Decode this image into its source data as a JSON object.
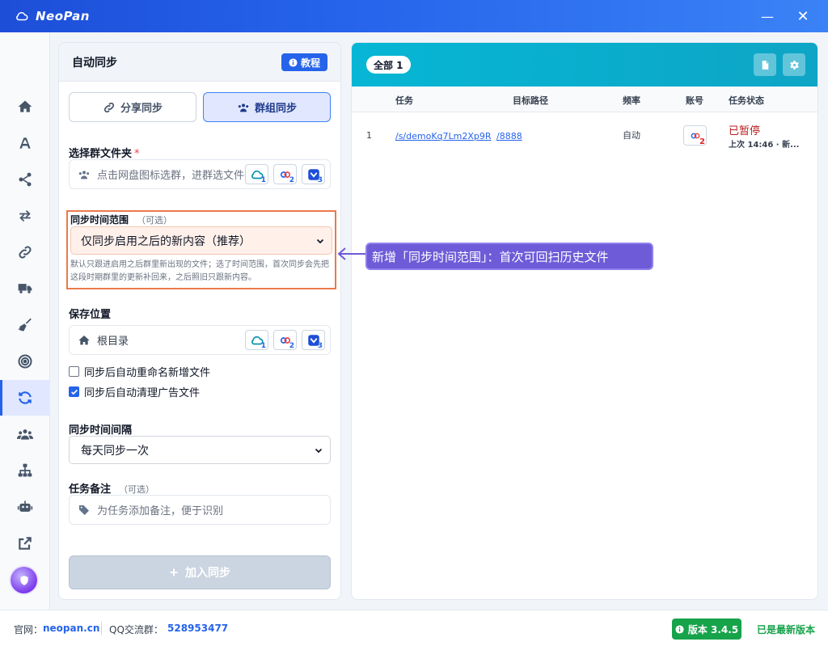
{
  "app": {
    "title": "NeoPan"
  },
  "window": {
    "minimize_glyph": "—",
    "close_glyph": "✕"
  },
  "sidebar": {
    "icons": [
      "home-icon",
      "font-icon",
      "share-nodes-icon",
      "arrows-exchange-icon",
      "link-icon",
      "truck-icon",
      "broom-icon",
      "target-icon",
      "sync-icon",
      "users-icon",
      "sitemap-icon",
      "robot-icon",
      "external-link-icon"
    ],
    "active_index": 8
  },
  "left_panel": {
    "title": "自动同步",
    "tutorial_label": "教程",
    "tabs": {
      "share": "分享同步",
      "group": "群组同步"
    },
    "group_folder": {
      "label": "选择群文件夹",
      "required_mark": "*",
      "placeholder": "点击网盘图标选群，进群选文件夹"
    },
    "sync_range": {
      "label": "同步时间范围",
      "optional": "（可选）",
      "selected": "仅同步启用之后的新内容（推荐）",
      "hint": "默认只跟进启用之后群里新出现的文件；选了时间范围，首次同步会先把这段时期群里的更新补回来，之后照旧只跟新内容。"
    },
    "save_location": {
      "label": "保存位置",
      "value": "根目录"
    },
    "disk_numbers": [
      "1",
      "2",
      "3"
    ],
    "options": [
      {
        "label": "同步后自动重命名新增文件",
        "checked": false
      },
      {
        "label": "同步后自动清理广告文件",
        "checked": true
      }
    ],
    "interval": {
      "label": "同步时间间隔",
      "selected": "每天同步一次"
    },
    "note": {
      "label": "任务备注",
      "optional": "（可选）",
      "placeholder": "为任务添加备注，便于识别"
    },
    "add_button": "加入同步"
  },
  "right_panel": {
    "filter_badge": "全部 1",
    "columns": [
      "任务",
      "目标路径",
      "频率",
      "账号",
      "任务状态"
    ],
    "rows": [
      {
        "index": "1",
        "task": "/s/demoKq7Lm2Xp9R",
        "target": "/8888",
        "frequency": "自动",
        "account_number": "2",
        "status": "已暂停",
        "status_detail": "上次 14:46 · 新..."
      }
    ]
  },
  "annotation": {
    "text": "新增「同步时间范围」：首次可回扫历史文件"
  },
  "footer": {
    "site_label": "官网：",
    "site": "neopan.cn",
    "qq_label": "QQ交流群：",
    "qq": "528953477",
    "version_label": "版本 3.4.5",
    "latest_label": "已是最新版本"
  },
  "colors": {
    "accent": "#2563eb",
    "header_teal": "#06b6d4",
    "highlight_border": "#ea7a4b",
    "callout": "#6d5bd8",
    "success": "#16a34a"
  }
}
